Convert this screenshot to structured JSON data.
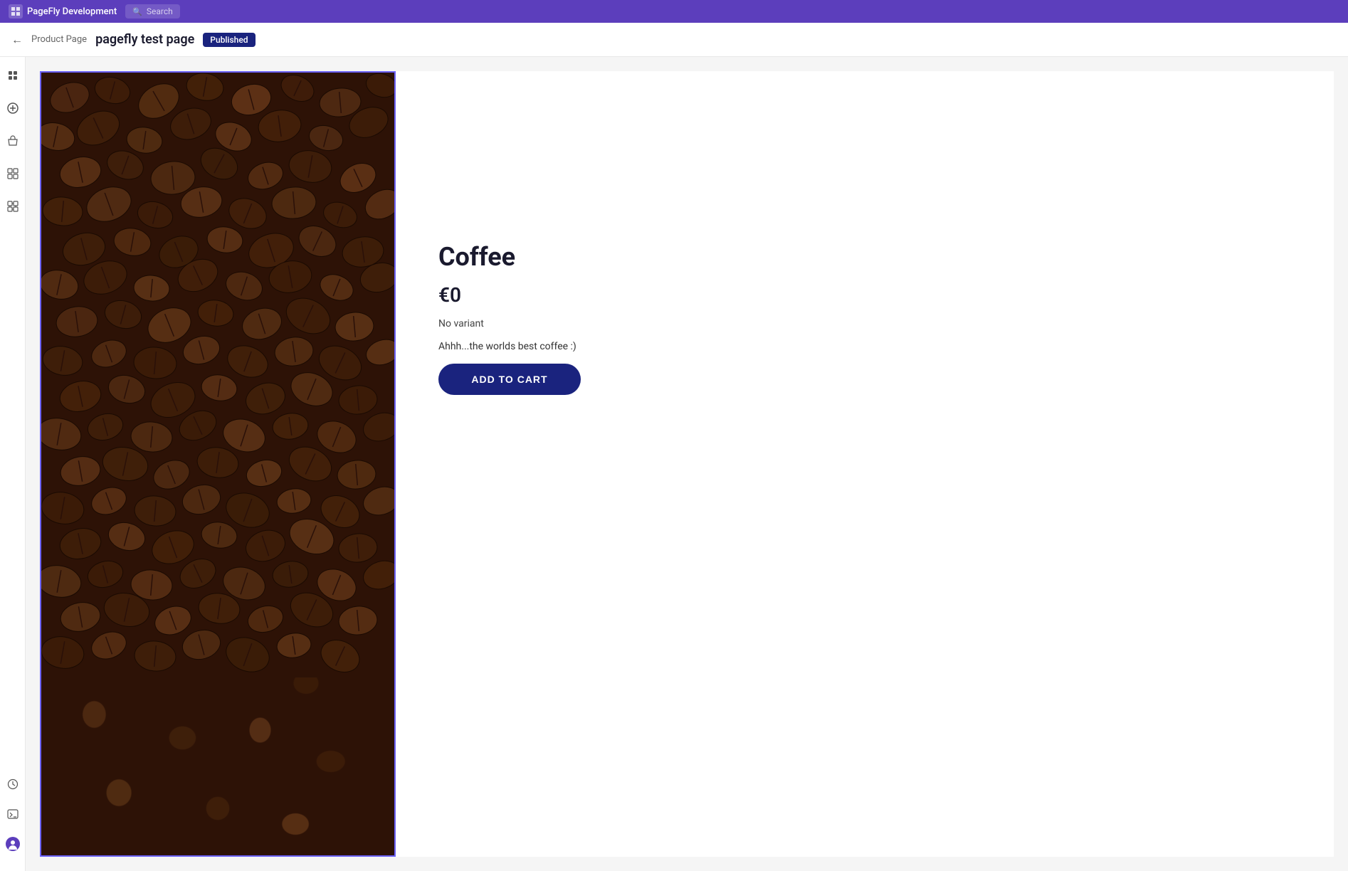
{
  "topNav": {
    "appName": "PageFly Development",
    "searchPlaceholder": "Search"
  },
  "secondaryHeader": {
    "backLabel": "←",
    "breadcrumb": "Product Page",
    "pageTitle": "pagefly test page",
    "statusBadge": "Published"
  },
  "sidebar": {
    "icons": [
      {
        "name": "layers-icon",
        "label": "Layers"
      },
      {
        "name": "add-icon",
        "label": "Add Element"
      },
      {
        "name": "store-icon",
        "label": "Store"
      },
      {
        "name": "grid-icon",
        "label": "Grid"
      },
      {
        "name": "components-icon",
        "label": "Components"
      }
    ],
    "bottomIcons": [
      {
        "name": "history-icon",
        "label": "History"
      },
      {
        "name": "terminal-icon",
        "label": "Terminal"
      },
      {
        "name": "user-icon",
        "label": "User"
      }
    ]
  },
  "product": {
    "name": "Coffee",
    "price": "€0",
    "variant": "No variant",
    "description": "Ahhh...the worlds best coffee :)",
    "addToCartLabel": "ADD TO CART"
  },
  "colors": {
    "navBg": "#5c3ebc",
    "publishedBadge": "#1a237e",
    "addToCartBtn": "#1a237e"
  }
}
